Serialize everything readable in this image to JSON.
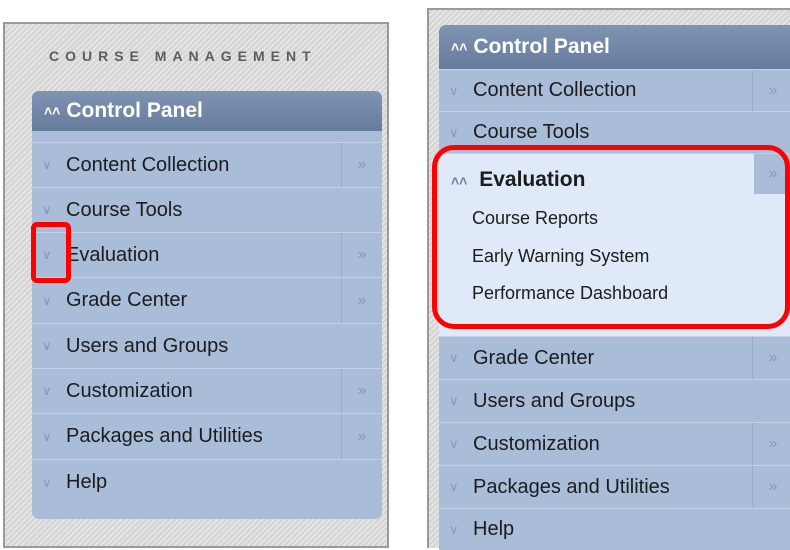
{
  "left_panel": {
    "title": "COURSE MANAGEMENT",
    "header": "Control Panel",
    "items": [
      {
        "label": "Content Collection",
        "arrow": "»"
      },
      {
        "label": "Course Tools",
        "arrow": ""
      },
      {
        "label": "Evaluation",
        "arrow": "»"
      },
      {
        "label": "Grade Center",
        "arrow": "»"
      },
      {
        "label": "Users and Groups",
        "arrow": ""
      },
      {
        "label": "Customization",
        "arrow": "»"
      },
      {
        "label": "Packages and Utilities",
        "arrow": "»"
      },
      {
        "label": "Help",
        "arrow": ""
      }
    ]
  },
  "right_panel": {
    "header": "Control Panel",
    "items_before": [
      {
        "label": "Content Collection",
        "arrow": "»"
      },
      {
        "label": "Course Tools",
        "arrow": ""
      }
    ],
    "expanded": {
      "label": "Evaluation",
      "arrow": "»",
      "sub_items": [
        "Course Reports",
        "Early Warning System",
        "Performance Dashboard"
      ]
    },
    "items_after": [
      {
        "label": "Grade Center",
        "arrow": "»"
      },
      {
        "label": "Users and Groups",
        "arrow": ""
      },
      {
        "label": "Customization",
        "arrow": "»"
      },
      {
        "label": "Packages and Utilities",
        "arrow": "»"
      },
      {
        "label": "Help",
        "arrow": ""
      }
    ]
  },
  "icons": {
    "collapsed": "chevron-down-double-icon",
    "expanded": "chevron-up-double-icon",
    "submenu": "double-arrow-right-icon"
  },
  "colors": {
    "highlight": "#ff0000",
    "header": "#7389aa",
    "menu": "#a9bcd8",
    "expanded_bg": "#dfe9f8"
  }
}
